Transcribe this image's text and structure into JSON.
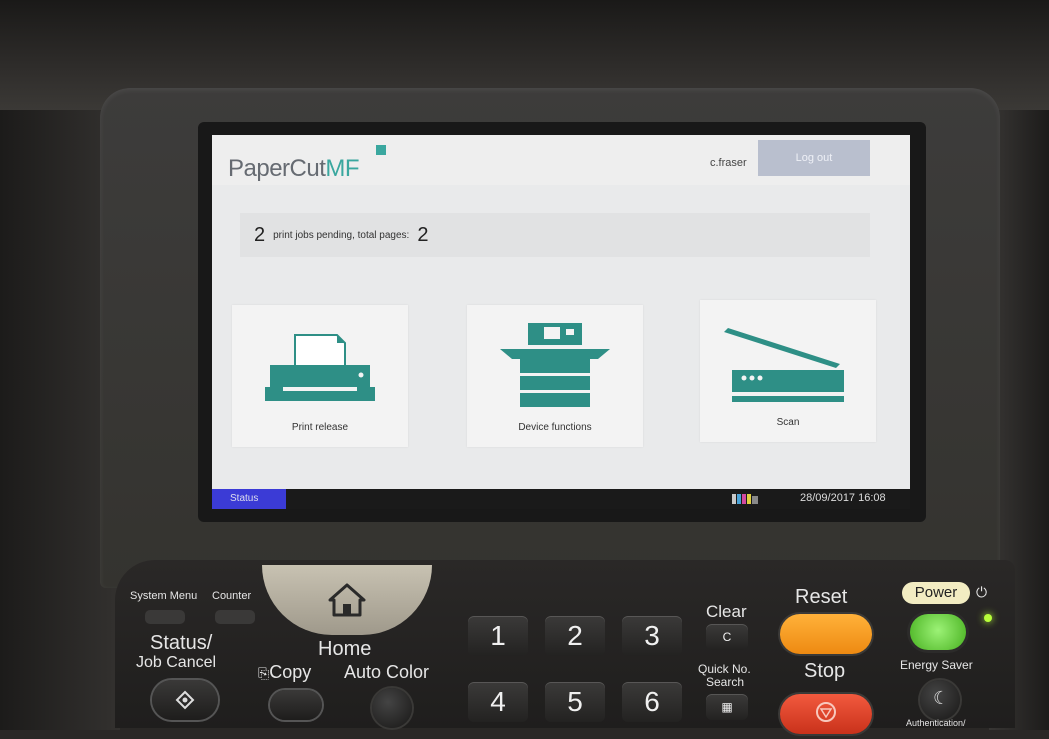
{
  "app": {
    "logo_main": "PaperCut",
    "logo_accent": "MF",
    "username": "c.fraser",
    "logout_label": "Log out"
  },
  "jobs": {
    "count": "2",
    "text": "print jobs pending, total pages:",
    "pages": "2"
  },
  "tiles": [
    {
      "label": "Print release",
      "icon": "printer-icon"
    },
    {
      "label": "Device functions",
      "icon": "copier-icon"
    },
    {
      "label": "Scan",
      "icon": "scanner-icon"
    }
  ],
  "statusbar": {
    "status_label": "Status",
    "datetime": "28/09/2017 16:08"
  },
  "panel": {
    "system_menu": "System Menu",
    "counter": "Counter",
    "status_job_cancel_1": "Status/",
    "status_job_cancel_2": "Job Cancel",
    "home": "Home",
    "copy": "Copy",
    "auto_color": "Auto Color",
    "clear": "Clear",
    "clear_key": "C",
    "quick_no_1": "Quick No.",
    "quick_no_2": "Search",
    "reset": "Reset",
    "stop": "Stop",
    "power": "Power",
    "energy_saver": "Energy Saver",
    "authentication": "Authentication/",
    "keys": [
      "1",
      "2",
      "3",
      "4",
      "5",
      "6"
    ]
  },
  "colors": {
    "accent": "#3aa79f",
    "logout_bg": "#b9bfce",
    "status_tab": "#3b3bd6",
    "reset_button": "#f39a21",
    "stop_button": "#e2452b",
    "power_button": "#59d12f"
  }
}
